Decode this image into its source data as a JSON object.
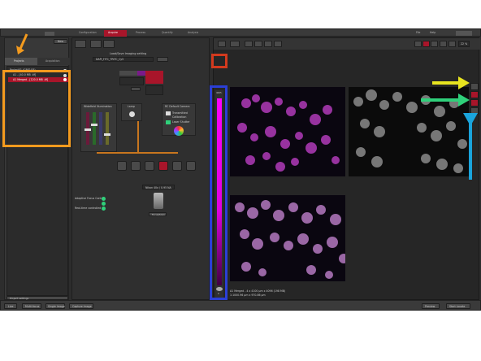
{
  "top_tabs": [
    "Configuration",
    "Acquire",
    "Process",
    "Quantify",
    "Analysis"
  ],
  "active_top_tab": "Acquire",
  "top_right": [
    "File",
    "Help"
  ],
  "left_panel": {
    "header_btn": "New",
    "tabs": [
      "Projects",
      "Acquisition"
    ],
    "tree": [
      {
        "label": "Project01 (GRID E8)",
        "selected": false
      },
      {
        "label": "A1 - [40.0 MB .tif]",
        "selected": false
      },
      {
        "label": "A1 Merged - [120.0 MB .tif]",
        "selected": true
      }
    ],
    "footer": "Project settings"
  },
  "acq": {
    "load_label": "Load/Save Imaging setting",
    "setting_value": "DAPI_FITC_TRITC_Cy5",
    "light_path_title": "Widefield Illumination",
    "lamp_title": "Lamp",
    "camera_title": "RC Default Camera",
    "camera_items": [
      "Transmitted",
      "Calibration",
      "Laser Shutter"
    ],
    "objective_label": "Nikon 40x / 0.95 NA",
    "adaptive_focus": "Adaptive Focus Control",
    "realtime": "Real-time controlled",
    "focus_btn": "Focus/Scan"
  },
  "viewer": {
    "info_line1": "A1 Merged - 4 x 4100 µm x 4096 (198 MB)",
    "info_line2": "1:1000.96 µm x 970.86 µm",
    "lut_top": "4095",
    "lut_bottom": "0",
    "zoom": "22 %"
  },
  "bottom_bar": {
    "left_buttons": [
      "Live",
      "Multi-focus",
      "Single Image",
      "Capture Image"
    ],
    "right_buttons": [
      "Preview",
      "Start Locate"
    ]
  },
  "annotation_colors": {
    "orange": "#f39a1e",
    "red": "#d23a1e",
    "blue": "#2b3fd6",
    "yellow": "#e8e41f",
    "green": "#2fd07a",
    "cyan": "#1aa4dc"
  }
}
